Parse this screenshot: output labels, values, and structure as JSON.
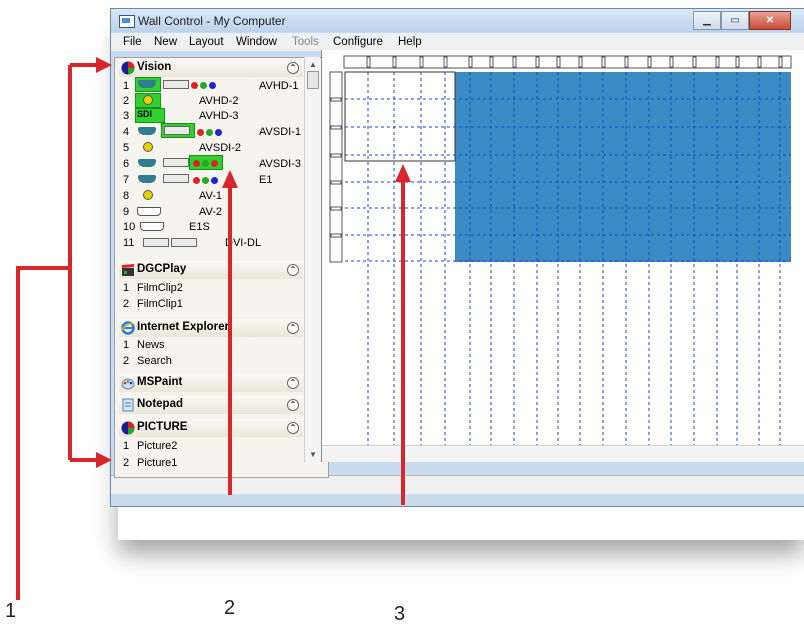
{
  "window": {
    "title": "Wall Control - My Computer"
  },
  "menu": [
    "File",
    "New",
    "Layout",
    "Window",
    "Tools",
    "Configure",
    "Help"
  ],
  "groups": [
    {
      "title": "Vision",
      "icon": "vision-logo-icon",
      "items": [
        {
          "n": "1",
          "label": "AVHD-1"
        },
        {
          "n": "2",
          "label": "AVHD-2"
        },
        {
          "n": "3",
          "label": "AVHD-3",
          "badge": "SDI"
        },
        {
          "n": "4",
          "label": "AVSDI-1"
        },
        {
          "n": "5",
          "label": "AVSDI-2"
        },
        {
          "n": "6",
          "label": "AVSDI-3"
        },
        {
          "n": "7",
          "label": "E1"
        },
        {
          "n": "8",
          "label": "AV-1"
        },
        {
          "n": "9",
          "label": "AV-2"
        },
        {
          "n": "10",
          "label": "E1S"
        },
        {
          "n": "11",
          "label": "DVI-DL"
        }
      ]
    },
    {
      "title": "DGCPlay",
      "icon": "clapperboard-icon",
      "items": [
        {
          "n": "1",
          "label": "FilmClip2"
        },
        {
          "n": "2",
          "label": "FilmClip1"
        }
      ]
    },
    {
      "title": "Internet Explorer",
      "icon": "internet-explorer-icon",
      "items": [
        {
          "n": "1",
          "label": "News"
        },
        {
          "n": "2",
          "label": "Search"
        }
      ]
    },
    {
      "title": "MSPaint",
      "icon": "paint-palette-icon",
      "items": []
    },
    {
      "title": "Notepad",
      "icon": "notepad-icon",
      "items": []
    },
    {
      "title": "PICTURE",
      "icon": "picture-logo-icon",
      "items": [
        {
          "n": "1",
          "label": "Picture2"
        },
        {
          "n": "2",
          "label": "Picture1"
        }
      ]
    }
  ],
  "callouts": [
    "1",
    "2",
    "3"
  ],
  "colors": {
    "wall_blue": "#3d8bc4",
    "highlight_green": "#2fd12f",
    "arrow_red": "#d8262a"
  },
  "icons": {
    "minimize": "minimize-icon",
    "maximize": "maximize-icon",
    "close": "close-icon",
    "collapse": "collapse-up-icon"
  }
}
